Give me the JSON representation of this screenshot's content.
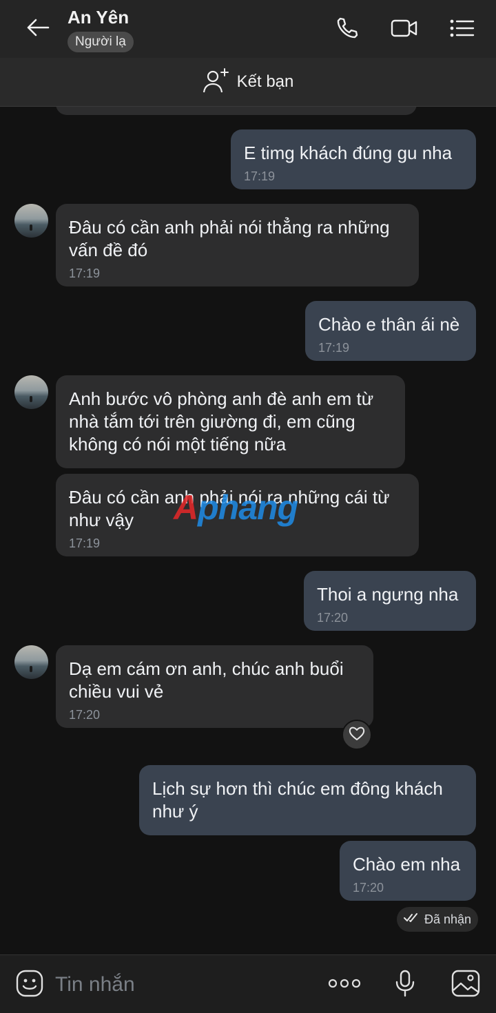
{
  "header": {
    "contact_name": "An Yên",
    "badge": "Người lạ",
    "back_icon": "arrow-left-icon",
    "call_icon": "phone-icon",
    "video_icon": "video-camera-icon",
    "menu_icon": "list-menu-icon"
  },
  "add_friend": {
    "label": "Kết bạn",
    "icon": "add-user-icon"
  },
  "messages": [
    {
      "dir": "out",
      "text": "E timg khách đúng gu nha",
      "time": "17:19"
    },
    {
      "dir": "in",
      "text": "Đâu có cần anh phải nói thẳng ra những vấn đề đó",
      "time": "17:19"
    },
    {
      "dir": "out",
      "text": "Chào e thân ái nè",
      "time": "17:19"
    },
    {
      "dir": "in",
      "text": "Anh bước vô phòng anh đè anh em từ nhà tắm tới trên giường đi, em cũng không có nói một tiếng nữa",
      "time": ""
    },
    {
      "dir": "in",
      "text": "Đâu có cần anh phải nói ra những cái từ như vậy",
      "time": "17:19"
    },
    {
      "dir": "out",
      "text": "Thoi a ngưng nha",
      "time": "17:20"
    },
    {
      "dir": "in",
      "text": "Dạ em cám ơn anh, chúc anh buổi chiều vui vẻ",
      "time": "17:20"
    },
    {
      "dir": "out",
      "text": "Lịch sự hơn thì chúc em đông khách như ý",
      "time": ""
    },
    {
      "dir": "out",
      "text": "Chào em nha",
      "time": "17:20"
    }
  ],
  "status": {
    "text": "Đã nhận",
    "icon": "double-check-icon"
  },
  "reaction_icon": "heart-icon",
  "watermark": {
    "first": "A",
    "rest": "phang"
  },
  "composer": {
    "placeholder": "Tin nhắn",
    "emoji_icon": "emoji-icon",
    "more_icon": "more-dots-icon",
    "mic_icon": "microphone-icon",
    "image_icon": "image-icon"
  },
  "colors": {
    "background": "#121212",
    "incoming_bubble": "#2d2d2e",
    "outgoing_bubble": "#3a4350"
  }
}
